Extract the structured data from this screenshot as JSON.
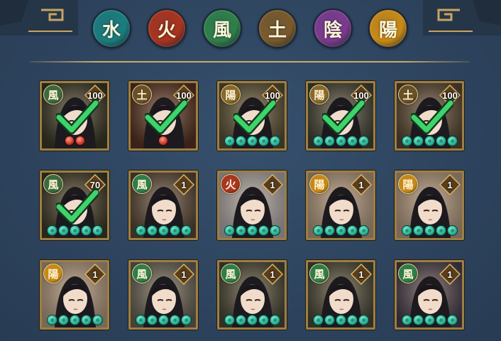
{
  "elements": [
    {
      "glyph": "水",
      "name": "water",
      "color": "#1b7d7e"
    },
    {
      "glyph": "火",
      "name": "fire",
      "color": "#a8341f"
    },
    {
      "glyph": "風",
      "name": "wind",
      "color": "#2f7f4a"
    },
    {
      "glyph": "土",
      "name": "earth",
      "color": "#7a5a2c"
    },
    {
      "glyph": "陰",
      "name": "yin",
      "color": "#7b3b8f"
    },
    {
      "glyph": "陽",
      "name": "yang",
      "color": "#c88a16"
    }
  ],
  "cards": [
    {
      "attr": "風",
      "attr_color": "#3c6b3f",
      "level": "100",
      "stars": "coin2",
      "selected": true,
      "tone": "#3a3a2a"
    },
    {
      "attr": "土",
      "attr_color": "#6b5127",
      "level": "100",
      "stars": "coin1",
      "selected": true,
      "tone": "#5b3526"
    },
    {
      "attr": "陽",
      "attr_color": "#8a6a2a",
      "level": "100",
      "stars": "5",
      "selected": true,
      "tone": "#5b5337"
    },
    {
      "attr": "陽",
      "attr_color": "#8a6a2a",
      "level": "100",
      "stars": "5",
      "selected": true,
      "tone": "#44463a"
    },
    {
      "attr": "土",
      "attr_color": "#6b5127",
      "level": "100",
      "stars": "5",
      "selected": true,
      "tone": "#5a4a36"
    },
    {
      "attr": "風",
      "attr_color": "#3c6b3f",
      "level": "70",
      "stars": "5",
      "selected": true,
      "tone": "#3f3c2a"
    },
    {
      "attr": "風",
      "attr_color": "#2f7f4a",
      "level": "1",
      "stars": "5",
      "selected": false,
      "tone": "#5b4a3a"
    },
    {
      "attr": "火",
      "attr_color": "#a8341f",
      "level": "1",
      "stars": "5",
      "selected": false,
      "tone": "#b7b2b4"
    },
    {
      "attr": "陽",
      "attr_color": "#c88a16",
      "level": "1",
      "stars": "5",
      "selected": false,
      "tone": "#b9a088"
    },
    {
      "attr": "陽",
      "attr_color": "#c88a16",
      "level": "1",
      "stars": "5",
      "selected": false,
      "tone": "#b9a088"
    },
    {
      "attr": "陽",
      "attr_color": "#c88a16",
      "level": "1",
      "stars": "5",
      "selected": false,
      "tone": "#b9a088"
    },
    {
      "attr": "風",
      "attr_color": "#2f7f4a",
      "level": "1",
      "stars": "5",
      "selected": false,
      "tone": "#6a665a"
    },
    {
      "attr": "風",
      "attr_color": "#2f7f4a",
      "level": "1",
      "stars": "5",
      "selected": false,
      "tone": "#4a4a3a"
    },
    {
      "attr": "風",
      "attr_color": "#2f7f4a",
      "level": "1",
      "stars": "5",
      "selected": false,
      "tone": "#4a4a3a"
    },
    {
      "attr": "風",
      "attr_color": "#2f7f4a",
      "level": "1",
      "stars": "5",
      "selected": false,
      "tone": "#4a4150"
    }
  ]
}
